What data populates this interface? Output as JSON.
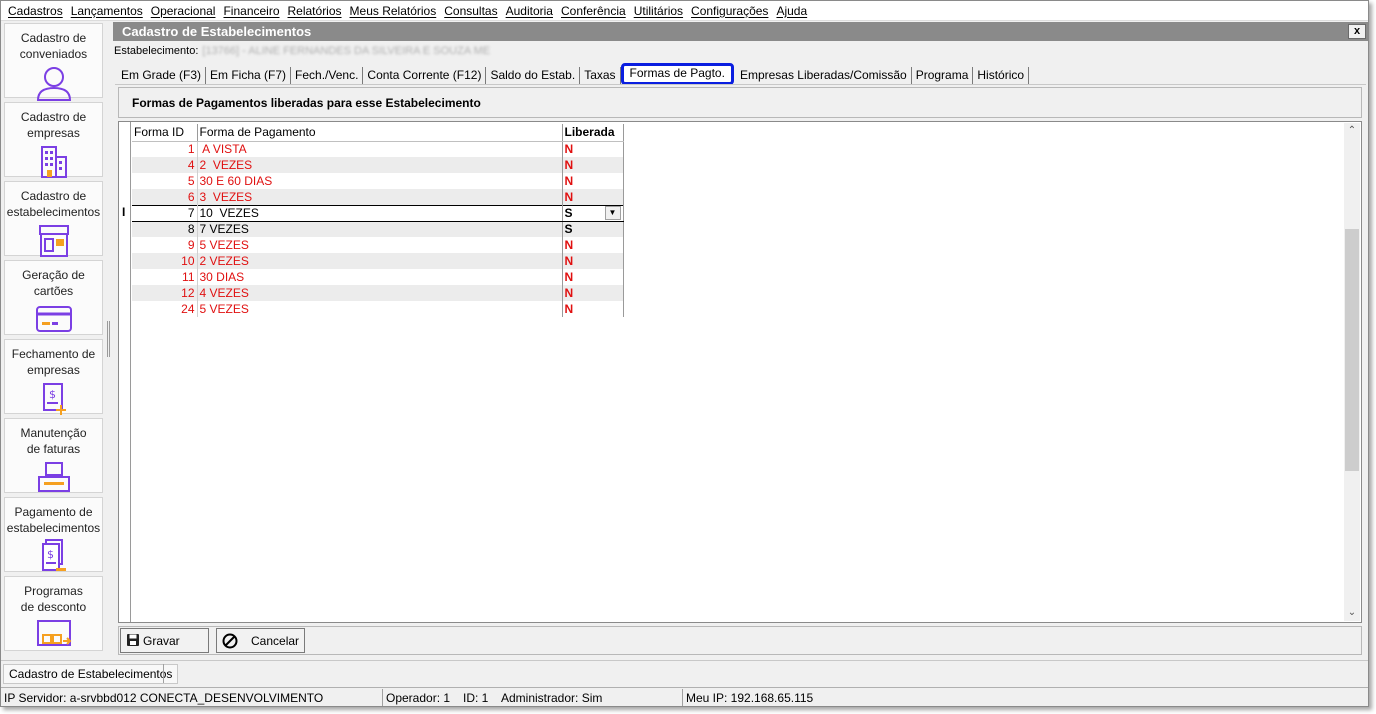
{
  "menu": [
    "Cadastros",
    "Lançamentos",
    "Operacional",
    "Financeiro",
    "Relatórios",
    "Meus Relatórios",
    "Consultas",
    "Auditoria",
    "Conferência",
    "Utilitários",
    "Configurações",
    "Ajuda"
  ],
  "sidebar": [
    {
      "label": "Cadastro de\nconveniados",
      "icon": "user-icon"
    },
    {
      "label": "Cadastro de\nempresas",
      "icon": "building-icon"
    },
    {
      "label": "Cadastro de\nestabelecimentos",
      "icon": "store-icon"
    },
    {
      "label": "Geração de\ncartões",
      "icon": "card-icon"
    },
    {
      "label": "Fechamento de\nempresas",
      "icon": "invoice-add-icon"
    },
    {
      "label": "Manutenção\nde faturas",
      "icon": "tray-icon"
    },
    {
      "label": "Pagamento de\nestabelecimentos",
      "icon": "invoice-pay-icon"
    },
    {
      "label": "Programas\nde desconto",
      "icon": "discount-icon"
    }
  ],
  "window": {
    "title": "Cadastro de Estabelecimentos",
    "close": "x",
    "estab_label": "Estabelecimento:",
    "estab_value": "[13766] - ALINE FERNANDES DA SILVEIRA E SOUZA ME"
  },
  "tabs": [
    "Em Grade (F3)",
    "Em Ficha (F7)",
    "Fech./Venc.",
    "Conta Corrente (F12)",
    "Saldo do Estab.",
    "Taxas",
    "Formas de Pagto.",
    "Empresas Liberadas/Comissão",
    "Programa",
    "Histórico"
  ],
  "active_tab": "Formas de Pagto.",
  "section_title": "Formas de Pagamentos liberadas para esse Estabelecimento",
  "grid": {
    "headers": {
      "id": "Forma ID",
      "desc": "Forma de Pagamento",
      "lib": "Liberada"
    },
    "rows": [
      {
        "id": "1",
        "desc": " A VISTA",
        "lib": "N"
      },
      {
        "id": "4",
        "desc": "2  VEZES",
        "lib": "N"
      },
      {
        "id": "5",
        "desc": "30 E 60 DIAS",
        "lib": "N"
      },
      {
        "id": "6",
        "desc": "3  VEZES",
        "lib": "N"
      },
      {
        "id": "7",
        "desc": "10  VEZES",
        "lib": "S"
      },
      {
        "id": "8",
        "desc": "7 VEZES",
        "lib": "S"
      },
      {
        "id": "9",
        "desc": "5 VEZES",
        "lib": "N"
      },
      {
        "id": "10",
        "desc": "2 VEZES",
        "lib": "N"
      },
      {
        "id": "11",
        "desc": "30 DIAS",
        "lib": "N"
      },
      {
        "id": "12",
        "desc": "4 VEZES",
        "lib": "N"
      },
      {
        "id": "24",
        "desc": "5 VEZES",
        "lib": "N"
      }
    ]
  },
  "buttons": {
    "save": "Gravar",
    "cancel": "Cancelar"
  },
  "taskbar": {
    "item": "Cadastro de Estabelecimentos"
  },
  "status": {
    "server": "IP Servidor: a-srvbbd012 CONECTA_DESENVOLVIMENTO",
    "operator": "Operador: 1",
    "id": "ID: 1",
    "admin": "Administrador: Sim",
    "ip": "Meu IP: 192.168.65.115"
  }
}
